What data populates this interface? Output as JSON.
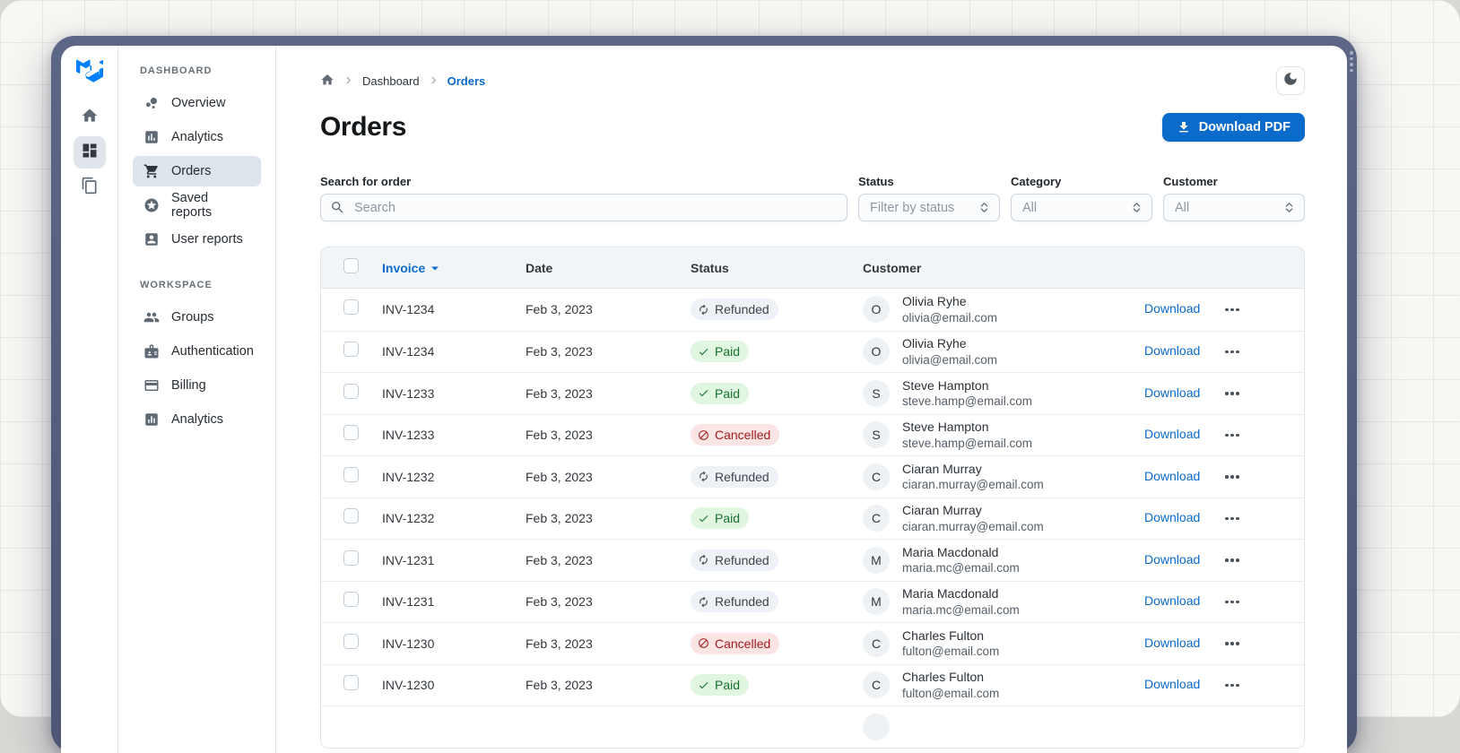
{
  "colors": {
    "accent": "#0b6bcb",
    "frame": "#545e80",
    "paid_bg": "#e0f6e0",
    "paid_text": "#17712f",
    "cancelled_bg": "#fbe4e4",
    "cancelled_text": "#a21d1d",
    "refunded_bg": "#eef2f6",
    "refunded_text": "#3e444b",
    "selected_nav_bg": "#dde4ec"
  },
  "window": {
    "theme_toggle_icon": "moon-icon",
    "scroll_indicator_icon": "scroll-dots"
  },
  "sidebar": {
    "rail": [
      {
        "name": "mui-logo",
        "icon": "mui-logo"
      },
      {
        "name": "home",
        "icon": "home-icon",
        "selected": false
      },
      {
        "name": "dashboard",
        "icon": "dashboard-grid-icon",
        "selected": true
      },
      {
        "name": "layers",
        "icon": "layers-icon",
        "selected": false
      }
    ],
    "sections": [
      {
        "label": "DASHBOARD",
        "items": [
          {
            "label": "Overview",
            "icon": "bubble-chart-icon",
            "selected": false
          },
          {
            "label": "Analytics",
            "icon": "bar-chart-icon",
            "selected": false
          },
          {
            "label": "Orders",
            "icon": "cart-icon",
            "selected": true
          },
          {
            "label": "Saved reports",
            "icon": "star-circle-icon",
            "selected": false
          },
          {
            "label": "User reports",
            "icon": "person-badge-icon",
            "selected": false
          }
        ]
      },
      {
        "label": "WORKSPACE",
        "items": [
          {
            "label": "Groups",
            "icon": "people-icon",
            "selected": false
          },
          {
            "label": "Authentication",
            "icon": "id-badge-icon",
            "selected": false
          },
          {
            "label": "Billing",
            "icon": "credit-card-icon",
            "selected": false
          },
          {
            "label": "Analytics",
            "icon": "analytics-icon",
            "selected": false
          }
        ]
      }
    ]
  },
  "breadcrumb": {
    "home_icon": "home-icon",
    "separator_icon": "chevron-right-icon",
    "items": [
      {
        "label": "Dashboard",
        "current": false
      },
      {
        "label": "Orders",
        "current": true
      }
    ]
  },
  "header": {
    "title": "Orders",
    "download_button_label": "Download PDF",
    "download_icon": "download-icon"
  },
  "filters": {
    "search": {
      "label": "Search for order",
      "placeholder": "Search",
      "value": "",
      "icon": "search-icon"
    },
    "status": {
      "label": "Status",
      "value": "Filter by status",
      "icon": "select-arrows-icon"
    },
    "category": {
      "label": "Category",
      "value": "All",
      "icon": "select-arrows-icon"
    },
    "customer": {
      "label": "Customer",
      "value": "All",
      "icon": "select-arrows-icon"
    }
  },
  "table": {
    "columns": {
      "invoice": "Invoice",
      "date": "Date",
      "status": "Status",
      "customer": "Customer"
    },
    "sort_column": "Invoice",
    "status_icons": {
      "Paid": "check-icon",
      "Refunded": "autorenew-icon",
      "Cancelled": "block-icon"
    },
    "row_action": {
      "download_label": "Download",
      "more_icon": "ellipsis-icon"
    },
    "rows": [
      {
        "invoice": "INV-1234",
        "date": "Feb 3, 2023",
        "status": "Refunded",
        "customer": {
          "initial": "O",
          "name": "Olivia Ryhe",
          "email": "olivia@email.com"
        }
      },
      {
        "invoice": "INV-1234",
        "date": "Feb 3, 2023",
        "status": "Paid",
        "customer": {
          "initial": "O",
          "name": "Olivia Ryhe",
          "email": "olivia@email.com"
        }
      },
      {
        "invoice": "INV-1233",
        "date": "Feb 3, 2023",
        "status": "Paid",
        "customer": {
          "initial": "S",
          "name": "Steve Hampton",
          "email": "steve.hamp@email.com"
        }
      },
      {
        "invoice": "INV-1233",
        "date": "Feb 3, 2023",
        "status": "Cancelled",
        "customer": {
          "initial": "S",
          "name": "Steve Hampton",
          "email": "steve.hamp@email.com"
        }
      },
      {
        "invoice": "INV-1232",
        "date": "Feb 3, 2023",
        "status": "Refunded",
        "customer": {
          "initial": "C",
          "name": "Ciaran Murray",
          "email": "ciaran.murray@email.com"
        }
      },
      {
        "invoice": "INV-1232",
        "date": "Feb 3, 2023",
        "status": "Paid",
        "customer": {
          "initial": "C",
          "name": "Ciaran Murray",
          "email": "ciaran.murray@email.com"
        }
      },
      {
        "invoice": "INV-1231",
        "date": "Feb 3, 2023",
        "status": "Refunded",
        "customer": {
          "initial": "M",
          "name": "Maria Macdonald",
          "email": "maria.mc@email.com"
        }
      },
      {
        "invoice": "INV-1231",
        "date": "Feb 3, 2023",
        "status": "Refunded",
        "customer": {
          "initial": "M",
          "name": "Maria Macdonald",
          "email": "maria.mc@email.com"
        }
      },
      {
        "invoice": "INV-1230",
        "date": "Feb 3, 2023",
        "status": "Cancelled",
        "customer": {
          "initial": "C",
          "name": "Charles Fulton",
          "email": "fulton@email.com"
        }
      },
      {
        "invoice": "INV-1230",
        "date": "Feb 3, 2023",
        "status": "Paid",
        "customer": {
          "initial": "C",
          "name": "Charles Fulton",
          "email": "fulton@email.com"
        }
      },
      {
        "invoice": "",
        "date": "",
        "status": "",
        "partial": true,
        "customer": {
          "initial": "",
          "name": "",
          "email": ""
        }
      }
    ]
  }
}
